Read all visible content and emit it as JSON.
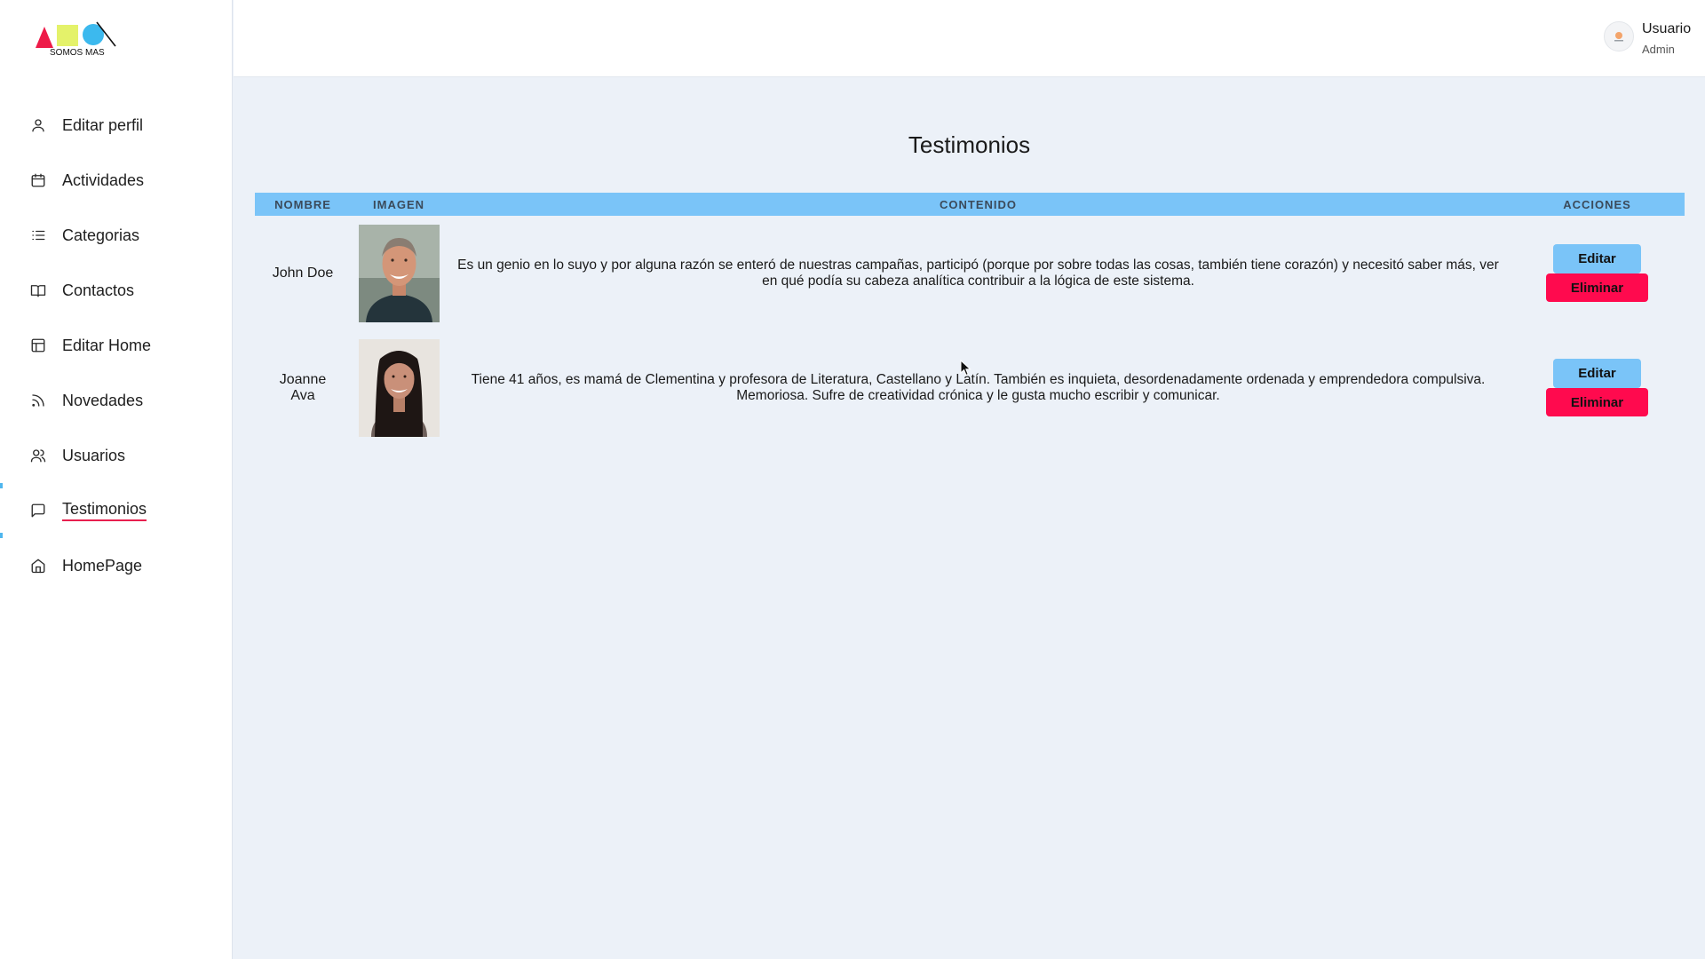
{
  "brand": {
    "logo_text": "SOMOS MAS"
  },
  "sidebar": {
    "items": [
      {
        "label": "Editar perfil",
        "icon": "user-icon"
      },
      {
        "label": "Actividades",
        "icon": "calendar-icon"
      },
      {
        "label": "Categorias",
        "icon": "list-icon"
      },
      {
        "label": "Contactos",
        "icon": "book-icon"
      },
      {
        "label": "Editar Home",
        "icon": "layout-icon"
      },
      {
        "label": "Novedades",
        "icon": "rss-icon"
      },
      {
        "label": "Usuarios",
        "icon": "users-icon"
      },
      {
        "label": "Testimonios",
        "icon": "message-icon",
        "active": true
      },
      {
        "label": "HomePage",
        "icon": "home-icon"
      }
    ]
  },
  "header": {
    "user_name": "Usuario",
    "user_role": "Admin"
  },
  "main": {
    "title": "Testimonios",
    "table": {
      "columns": [
        "NOMBRE",
        "IMAGEN",
        "CONTENIDO",
        "ACCIONES"
      ],
      "rows": [
        {
          "name": "John Doe",
          "content": "Es un genio en lo suyo y por alguna razón se enteró de nuestras campañas, participó (porque por sobre todas las cosas, también tiene corazón) y necesitó saber más, ver en qué podía su cabeza analítica contribuir a la lógica de este sistema.",
          "edit_label": "Editar",
          "delete_label": "Eliminar"
        },
        {
          "name": "Joanne Ava",
          "content": "Tiene 41 años, es mamá de Clementina y profesora de Literatura, Castellano y Latín. También es inquieta, desordenadamente ordenada y emprendedora compulsiva. Memoriosa. Sufre de creatividad crónica y le gusta mucho escribir y comunicar.",
          "edit_label": "Editar",
          "delete_label": "Eliminar"
        }
      ]
    }
  },
  "colors": {
    "accent": "#7ac4f8",
    "danger": "#ff0a4e",
    "active_underline": "#e8204e",
    "background": "#ecf1f8"
  }
}
